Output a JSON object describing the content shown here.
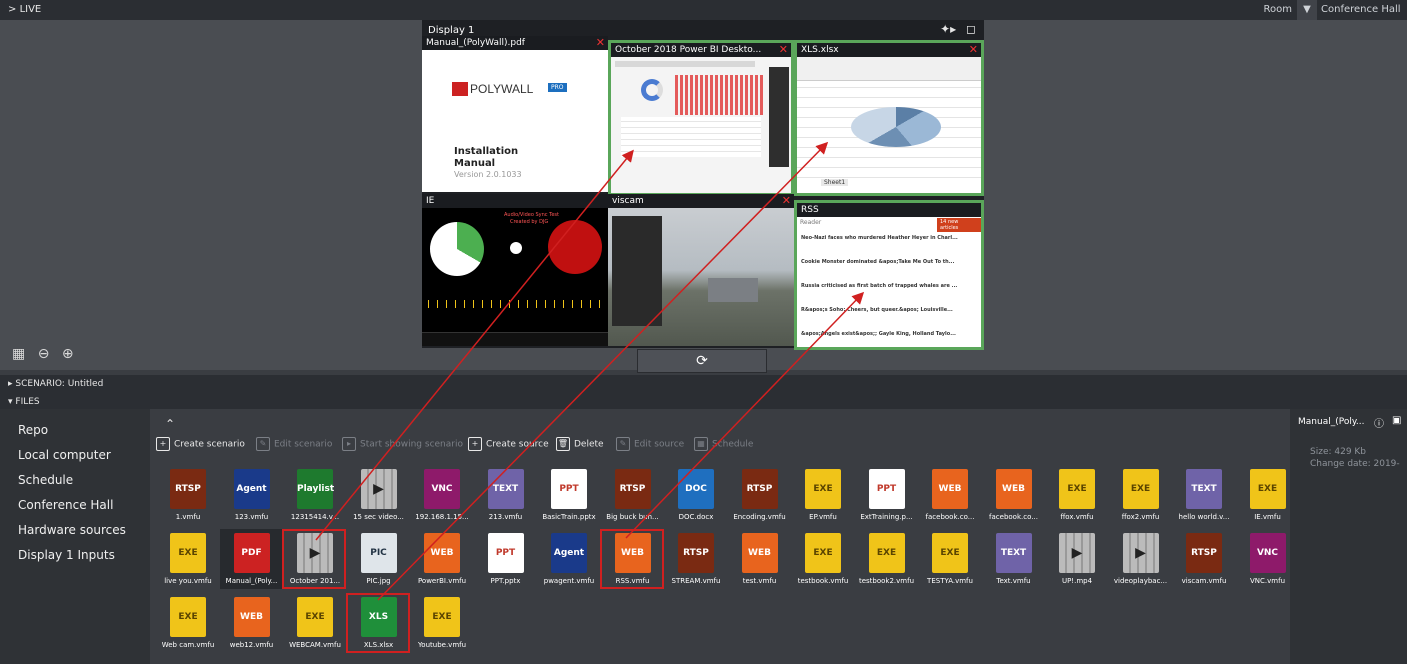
{
  "topbar": {
    "live_label": "LIVE",
    "room_label": "Room",
    "room_value": "Conference Hall"
  },
  "display": {
    "title": "Display 1",
    "windows": [
      {
        "title": "Manual_(PolyWall).pdf",
        "brand": "POLYWALL",
        "badge": "PRO",
        "line1": "Installation",
        "line2": "Manual",
        "line3": "Version 2.0.1033"
      },
      {
        "title": "October 2018 Power BI Deskto..."
      },
      {
        "title": "XLS.xlsx"
      },
      {
        "title": "IE",
        "caption1": "Audio/Video Sync Test",
        "caption2": "Created by DJG"
      },
      {
        "title": "viscam"
      },
      {
        "title": "RSS",
        "reader": "Reader",
        "button": "14 new articles",
        "items": [
          "Neo-Nazi faces who murdered Heather Heyer in Charl...",
          "Cookie Monster dominated &apos;Take Me Out To th...",
          "Russia criticised as first batch of trapped whales are ...",
          "R&apos;s Soho: Cheers, but queer.&apos; Louisville...",
          "&apos;Angels exist&apos;; Gayle King, Holland Taylo..."
        ]
      }
    ]
  },
  "scenario_label": "SCENARIO: Untitled",
  "files_label": "FILES",
  "sidebar": {
    "items": [
      "Repo",
      "Local computer",
      "Schedule",
      "Conference Hall",
      "Hardware sources",
      "Display 1 Inputs"
    ]
  },
  "toolbar": {
    "create_scenario": "Create scenario",
    "edit_scenario": "Edit scenario",
    "start_showing": "Start showing scenario",
    "create_source": "Create source",
    "delete": "Delete",
    "edit_source": "Edit source",
    "schedule": "Schedule"
  },
  "files": [
    {
      "icon": "RTSP",
      "name": "1.vmfu"
    },
    {
      "icon": "Agent",
      "name": "123.vmfu"
    },
    {
      "icon": "Playlist",
      "name": "12315414.v..."
    },
    {
      "icon": "VID",
      "name": "15 sec video..."
    },
    {
      "icon": "VNC",
      "name": "192.168.1.15..."
    },
    {
      "icon": "TEXT",
      "name": "213.vmfu"
    },
    {
      "icon": "PPT",
      "name": "BasicTrain.pptx"
    },
    {
      "icon": "RTSP",
      "name": "Big buck bun..."
    },
    {
      "icon": "DOC",
      "name": "DOC.docx"
    },
    {
      "icon": "RTSP",
      "name": "Encoding.vmfu"
    },
    {
      "icon": "EXE",
      "name": "EP.vmfu"
    },
    {
      "icon": "PPT",
      "name": "ExtTraining.p..."
    },
    {
      "icon": "WEB",
      "name": "facebook.co..."
    },
    {
      "icon": "WEB",
      "name": "facebook.co..."
    },
    {
      "icon": "EXE",
      "name": "ffox.vmfu"
    },
    {
      "icon": "EXE",
      "name": "ffox2.vmfu"
    },
    {
      "icon": "TEXT",
      "name": "hello world.v..."
    },
    {
      "icon": "EXE",
      "name": "IE.vmfu"
    },
    {
      "icon": "EXE",
      "name": "live you.vmfu"
    },
    {
      "icon": "PDF",
      "name": "Manual_(Poly..."
    },
    {
      "icon": "VID",
      "name": "October 201..."
    },
    {
      "icon": "PIC",
      "name": "PIC.jpg"
    },
    {
      "icon": "WEB",
      "name": "PowerBI.vmfu"
    },
    {
      "icon": "PPT",
      "name": "PPT.pptx"
    },
    {
      "icon": "Agent",
      "name": "pwagent.vmfu"
    },
    {
      "icon": "WEB",
      "name": "RSS.vmfu"
    },
    {
      "icon": "RTSP",
      "name": "STREAM.vmfu"
    },
    {
      "icon": "WEB",
      "name": "test.vmfu"
    },
    {
      "icon": "EXE",
      "name": "testbook.vmfu"
    },
    {
      "icon": "EXE",
      "name": "testbook2.vmfu"
    },
    {
      "icon": "EXE",
      "name": "TESTYA.vmfu"
    },
    {
      "icon": "TEXT",
      "name": "Text.vmfu"
    },
    {
      "icon": "VID",
      "name": "UP!.mp4"
    },
    {
      "icon": "VID",
      "name": "videoplaybac..."
    },
    {
      "icon": "RTSP",
      "name": "viscam.vmfu"
    },
    {
      "icon": "VNC",
      "name": "VNC.vmfu"
    },
    {
      "icon": "EXE",
      "name": "Web cam.vmfu"
    },
    {
      "icon": "WEB",
      "name": "web12.vmfu"
    },
    {
      "icon": "EXE",
      "name": "WEBCAM.vmfu"
    },
    {
      "icon": "XLS",
      "name": "XLS.xlsx"
    },
    {
      "icon": "EXE",
      "name": "Youtube.vmfu"
    }
  ],
  "info": {
    "filename": "Manual_(Poly...",
    "size": "Size: 429 Kb",
    "change_date": "Change date: 2019-"
  },
  "colors": {
    "selection_green": "#5aa65a",
    "highlight_red": "#d02020",
    "rtsp": "#7a2a12",
    "exe": "#f0c419",
    "web": "#e8641e",
    "vnc": "#8e1a6a",
    "text": "#6f63a8",
    "doc": "#1f6fbf",
    "xls": "#1f8f3a",
    "pdf": "#cc2222",
    "playlist": "#1e7a2e",
    "agent": "#1a3a8a"
  }
}
